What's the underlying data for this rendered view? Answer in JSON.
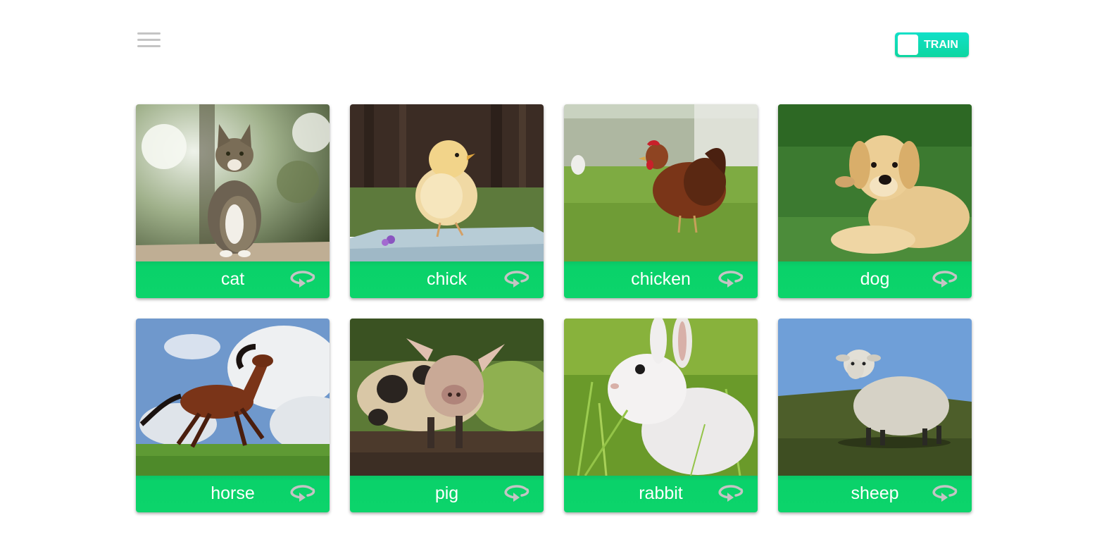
{
  "header": {
    "menu_icon": "hamburger-menu-icon",
    "toggle": {
      "label": "TRAIN",
      "state": "on",
      "color": "#10dcb4"
    }
  },
  "colors": {
    "card_footer": "#0cd46b",
    "flip_icon": "#c4c4c4",
    "menu_icon": "#c4c4c4"
  },
  "cards": [
    {
      "label": "cat",
      "image": "cat-photo",
      "flip_icon": "rotate-icon"
    },
    {
      "label": "chick",
      "image": "chick-photo",
      "flip_icon": "rotate-icon"
    },
    {
      "label": "chicken",
      "image": "chicken-photo",
      "flip_icon": "rotate-icon"
    },
    {
      "label": "dog",
      "image": "dog-photo",
      "flip_icon": "rotate-icon"
    },
    {
      "label": "horse",
      "image": "horse-photo",
      "flip_icon": "rotate-icon"
    },
    {
      "label": "pig",
      "image": "pig-photo",
      "flip_icon": "rotate-icon"
    },
    {
      "label": "rabbit",
      "image": "rabbit-photo",
      "flip_icon": "rotate-icon"
    },
    {
      "label": "sheep",
      "image": "sheep-photo",
      "flip_icon": "rotate-icon"
    }
  ]
}
